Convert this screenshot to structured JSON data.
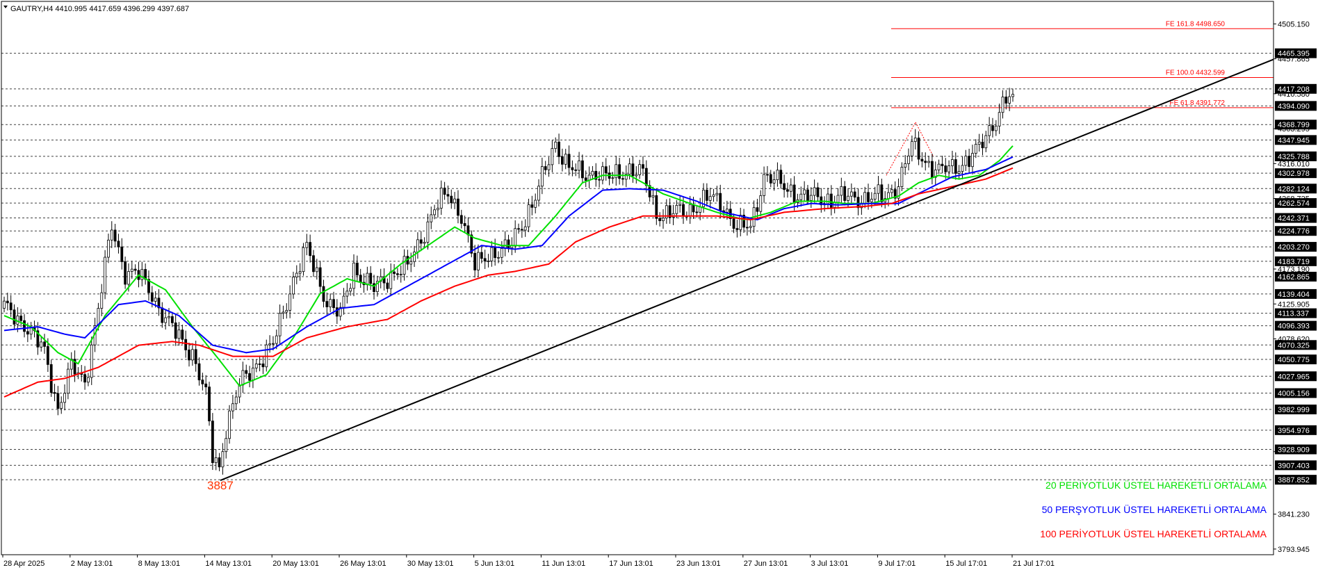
{
  "header": {
    "symbol_line": "GAUTRY,H4  4410.995 4417.659 4396.299 4397.687",
    "menu_icon": "triangle-down-icon"
  },
  "colors": {
    "background": "#ffffff",
    "frame": "#000000",
    "grid": "#000000",
    "candles": "#000000",
    "ema20": "#00e000",
    "ema50": "#0000ff",
    "ema100": "#ff0000",
    "fib": "#ff0000",
    "trendline": "#000000",
    "low_label": "#ff3300"
  },
  "chart_data": {
    "type": "candlestick",
    "title": "GAUTRY,H4",
    "ohlc_last": {
      "open": 4410.995,
      "high": 4417.659,
      "low": 4396.299,
      "close": 4397.687
    },
    "ylim": [
      3775,
      4530
    ],
    "x_ticks": [
      "28 Apr 2025",
      "2 May 13:01",
      "8 May 13:01",
      "14 May 13:01",
      "20 May 13:01",
      "26 May 13:01",
      "30 May 13:01",
      "5 Jun 13:01",
      "11 Jun 13:01",
      "17 Jun 13:01",
      "23 Jun 13:01",
      "27 Jun 13:01",
      "3 Jul 13:01",
      "9 Jul 17:01",
      "15 Jul 17:01",
      "21 Jul 17:01"
    ],
    "y_scale_labels": [
      "4505.150",
      "4457.865",
      "4410.580",
      "4363.295",
      "4316.010",
      "4268.725",
      "4173.190",
      "4125.905",
      "4078.620",
      "3925.890",
      "3841.230",
      "3793.945"
    ],
    "level_labels": [
      "4465.395",
      "4417.208",
      "4394.090",
      "4368.799",
      "4347.945",
      "4325.788",
      "4302.978",
      "4282.124",
      "4262.574",
      "4242.371",
      "4224.776",
      "4203.270",
      "4183.719",
      "4162.865",
      "4139.404",
      "4113.337",
      "4096.393",
      "4070.325",
      "4050.775",
      "4027.965",
      "4005.156",
      "3982.999",
      "3954.976",
      "3928.909",
      "3907.403",
      "3887.852"
    ],
    "fib_extensions": [
      {
        "label": "FE 161.8 4498.650",
        "value": 4498.65
      },
      {
        "label": "FE 100.0 4432.599",
        "value": 4432.599
      },
      {
        "label": "FE 61.8 4391.772",
        "value": 4391.772
      }
    ],
    "swing_low_label": "3887",
    "swing_low_value": 3887,
    "trendline_points": [
      {
        "x": "14 May 13:01",
        "y": 3887
      },
      {
        "x": "21 Jul 17:01",
        "y": 4316
      }
    ],
    "series": [
      {
        "name": "20 PERİYOTLUK ÜSTEL HAREKETLİ ORTALAMA",
        "color": "#00e000",
        "keypoints": [
          [
            0,
            4110
          ],
          [
            8,
            4095
          ],
          [
            16,
            4060
          ],
          [
            22,
            4045
          ],
          [
            30,
            4110
          ],
          [
            40,
            4165
          ],
          [
            48,
            4145
          ],
          [
            56,
            4095
          ],
          [
            64,
            4050
          ],
          [
            70,
            4015
          ],
          [
            78,
            4030
          ],
          [
            86,
            4080
          ],
          [
            94,
            4140
          ],
          [
            102,
            4160
          ],
          [
            110,
            4150
          ],
          [
            118,
            4180
          ],
          [
            126,
            4205
          ],
          [
            134,
            4230
          ],
          [
            140,
            4215
          ],
          [
            148,
            4205
          ],
          [
            156,
            4205
          ],
          [
            164,
            4245
          ],
          [
            172,
            4290
          ],
          [
            178,
            4300
          ],
          [
            186,
            4300
          ],
          [
            196,
            4275
          ],
          [
            204,
            4262
          ],
          [
            212,
            4250
          ],
          [
            220,
            4240
          ],
          [
            228,
            4250
          ],
          [
            236,
            4265
          ],
          [
            244,
            4265
          ],
          [
            250,
            4262
          ],
          [
            258,
            4262
          ],
          [
            266,
            4272
          ],
          [
            272,
            4290
          ],
          [
            278,
            4300
          ],
          [
            284,
            4295
          ],
          [
            290,
            4300
          ],
          [
            296,
            4320
          ],
          [
            300,
            4340
          ]
        ]
      },
      {
        "name": "50 PERŞYOTLUK ÜSTEL HAREKETLİ ORTALAMA",
        "color": "#0000ff",
        "keypoints": [
          [
            0,
            4090
          ],
          [
            10,
            4095
          ],
          [
            18,
            4085
          ],
          [
            24,
            4080
          ],
          [
            34,
            4125
          ],
          [
            42,
            4130
          ],
          [
            52,
            4110
          ],
          [
            62,
            4070
          ],
          [
            72,
            4060
          ],
          [
            80,
            4065
          ],
          [
            90,
            4095
          ],
          [
            100,
            4120
          ],
          [
            110,
            4125
          ],
          [
            122,
            4155
          ],
          [
            132,
            4180
          ],
          [
            142,
            4205
          ],
          [
            152,
            4200
          ],
          [
            160,
            4205
          ],
          [
            168,
            4245
          ],
          [
            178,
            4280
          ],
          [
            186,
            4282
          ],
          [
            196,
            4280
          ],
          [
            206,
            4265
          ],
          [
            214,
            4250
          ],
          [
            224,
            4240
          ],
          [
            232,
            4255
          ],
          [
            240,
            4262
          ],
          [
            248,
            4260
          ],
          [
            258,
            4262
          ],
          [
            266,
            4262
          ],
          [
            274,
            4280
          ],
          [
            282,
            4298
          ],
          [
            292,
            4308
          ],
          [
            300,
            4325
          ]
        ]
      },
      {
        "name": "100 PERİYOTLUK ÜSTEL HAREKETLİ ORTALAMA",
        "color": "#ff0000",
        "keypoints": [
          [
            0,
            4000
          ],
          [
            10,
            4020
          ],
          [
            18,
            4025
          ],
          [
            28,
            4040
          ],
          [
            40,
            4070
          ],
          [
            50,
            4075
          ],
          [
            58,
            4070
          ],
          [
            68,
            4055
          ],
          [
            80,
            4055
          ],
          [
            90,
            4080
          ],
          [
            102,
            4095
          ],
          [
            114,
            4105
          ],
          [
            124,
            4130
          ],
          [
            134,
            4150
          ],
          [
            144,
            4165
          ],
          [
            152,
            4170
          ],
          [
            162,
            4180
          ],
          [
            170,
            4210
          ],
          [
            180,
            4230
          ],
          [
            190,
            4245
          ],
          [
            200,
            4245
          ],
          [
            212,
            4245
          ],
          [
            222,
            4240
          ],
          [
            232,
            4250
          ],
          [
            244,
            4255
          ],
          [
            256,
            4258
          ],
          [
            264,
            4262
          ],
          [
            272,
            4275
          ],
          [
            282,
            4285
          ],
          [
            292,
            4295
          ],
          [
            300,
            4310
          ]
        ]
      }
    ],
    "price_path_keypoints": [
      [
        0,
        4120
      ],
      [
        6,
        4100
      ],
      [
        12,
        4060
      ],
      [
        16,
        3985
      ],
      [
        20,
        4040
      ],
      [
        24,
        4020
      ],
      [
        28,
        4120
      ],
      [
        32,
        4230
      ],
      [
        36,
        4170
      ],
      [
        40,
        4165
      ],
      [
        44,
        4140
      ],
      [
        48,
        4105
      ],
      [
        52,
        4080
      ],
      [
        56,
        4060
      ],
      [
        60,
        4000
      ],
      [
        62,
        3920
      ],
      [
        64,
        3905
      ],
      [
        66,
        3960
      ],
      [
        70,
        4015
      ],
      [
        74,
        4040
      ],
      [
        80,
        4070
      ],
      [
        86,
        4160
      ],
      [
        90,
        4200
      ],
      [
        96,
        4130
      ],
      [
        100,
        4110
      ],
      [
        104,
        4175
      ],
      [
        110,
        4145
      ],
      [
        116,
        4170
      ],
      [
        120,
        4175
      ],
      [
        128,
        4255
      ],
      [
        132,
        4275
      ],
      [
        136,
        4248
      ],
      [
        140,
        4175
      ],
      [
        144,
        4195
      ],
      [
        150,
        4200
      ],
      [
        158,
        4270
      ],
      [
        164,
        4345
      ],
      [
        168,
        4310
      ],
      [
        172,
        4300
      ],
      [
        176,
        4305
      ],
      [
        180,
        4295
      ],
      [
        186,
        4310
      ],
      [
        190,
        4300
      ],
      [
        194,
        4250
      ],
      [
        198,
        4248
      ],
      [
        202,
        4250
      ],
      [
        206,
        4260
      ],
      [
        210,
        4270
      ],
      [
        214,
        4260
      ],
      [
        218,
        4228
      ],
      [
        222,
        4230
      ],
      [
        226,
        4300
      ],
      [
        230,
        4290
      ],
      [
        234,
        4280
      ],
      [
        238,
        4270
      ],
      [
        242,
        4270
      ],
      [
        246,
        4268
      ],
      [
        250,
        4270
      ],
      [
        254,
        4270
      ],
      [
        258,
        4270
      ],
      [
        262,
        4270
      ],
      [
        266,
        4290
      ],
      [
        270,
        4340
      ],
      [
        274,
        4320
      ],
      [
        278,
        4305
      ],
      [
        282,
        4310
      ],
      [
        286,
        4320
      ],
      [
        290,
        4335
      ],
      [
        294,
        4370
      ],
      [
        298,
        4405
      ],
      [
        300,
        4400
      ]
    ]
  },
  "legend": {
    "ema20": "20 PERİYOTLUK ÜSTEL HAREKETLİ ORTALAMA",
    "ema50": "50 PERŞYOTLUK ÜSTEL HAREKETLİ ORTALAMA",
    "ema100": "100 PERİYOTLUK ÜSTEL HAREKETLİ ORTALAMA"
  }
}
